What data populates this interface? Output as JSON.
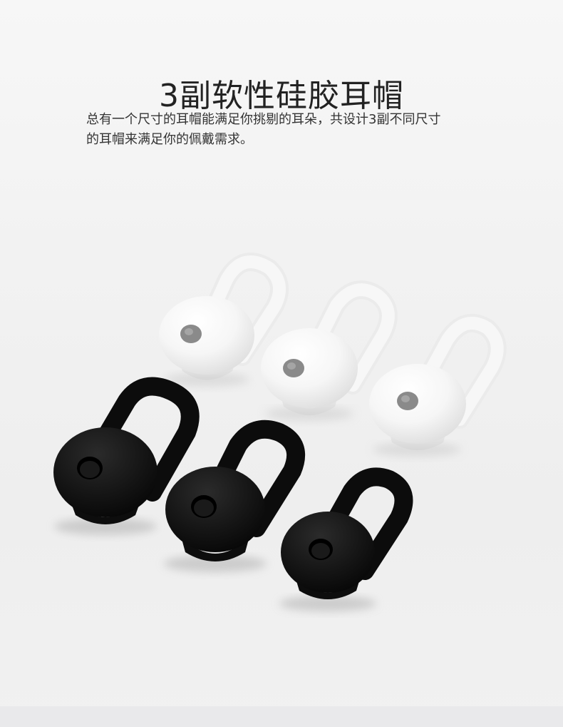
{
  "header": {
    "title": "3副软性硅胶耳帽"
  },
  "description": {
    "line1": "总有一个尺寸的耳帽能满足你挑剔的耳朵，共设计3副不同尺寸",
    "line2": "的耳帽来满足你的佩戴需求。"
  },
  "product": {
    "colors": {
      "white_tip": "#f5f5f5",
      "black_tip": "#111111",
      "nozzle_gray": "#8a8a8a"
    }
  }
}
